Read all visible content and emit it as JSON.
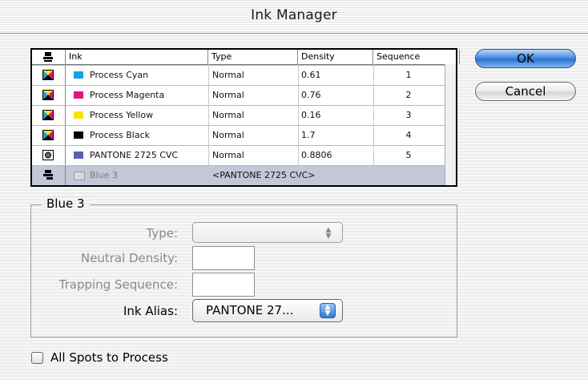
{
  "window": {
    "title": "Ink Manager"
  },
  "table": {
    "headers": {
      "ink": "Ink",
      "type": "Type",
      "density": "Density",
      "sequence": "Sequence"
    },
    "rows": [
      {
        "icon": "process-ink-icon",
        "color": "#1aa0e0",
        "name": "Process Cyan",
        "type": "Normal",
        "density": "0.61",
        "sequence": "1",
        "selected": false
      },
      {
        "icon": "process-ink-icon",
        "color": "#e0157d",
        "name": "Process Magenta",
        "type": "Normal",
        "density": "0.76",
        "sequence": "2",
        "selected": false
      },
      {
        "icon": "process-ink-icon",
        "color": "#f5e600",
        "name": "Process Yellow",
        "type": "Normal",
        "density": "0.16",
        "sequence": "3",
        "selected": false
      },
      {
        "icon": "process-ink-icon",
        "color": "#000000",
        "name": "Process Black",
        "type": "Normal",
        "density": "1.7",
        "sequence": "4",
        "selected": false
      },
      {
        "icon": "spot-ink-icon",
        "color": "#5a5fb0",
        "name": "PANTONE 2725 CVC",
        "type": "Normal",
        "density": "0.8806",
        "sequence": "5",
        "selected": false
      },
      {
        "icon": "alias-ink-icon",
        "color": "#d8d8d8",
        "name": "Blue 3",
        "type": "<PANTONE 2725 CVC>",
        "density": "",
        "sequence": "",
        "selected": true
      }
    ]
  },
  "buttons": {
    "ok": "OK",
    "cancel": "Cancel"
  },
  "details": {
    "group_title": "Blue 3",
    "type_label": "Type:",
    "type_value": "",
    "neutral_density_label": "Neutral Density:",
    "neutral_density_value": "",
    "trapping_sequence_label": "Trapping Sequence:",
    "trapping_sequence_value": "",
    "ink_alias_label": "Ink Alias:",
    "ink_alias_value": "PANTONE 27..."
  },
  "options": {
    "all_spots_to_process": "All Spots to Process",
    "all_spots_checked": false
  }
}
